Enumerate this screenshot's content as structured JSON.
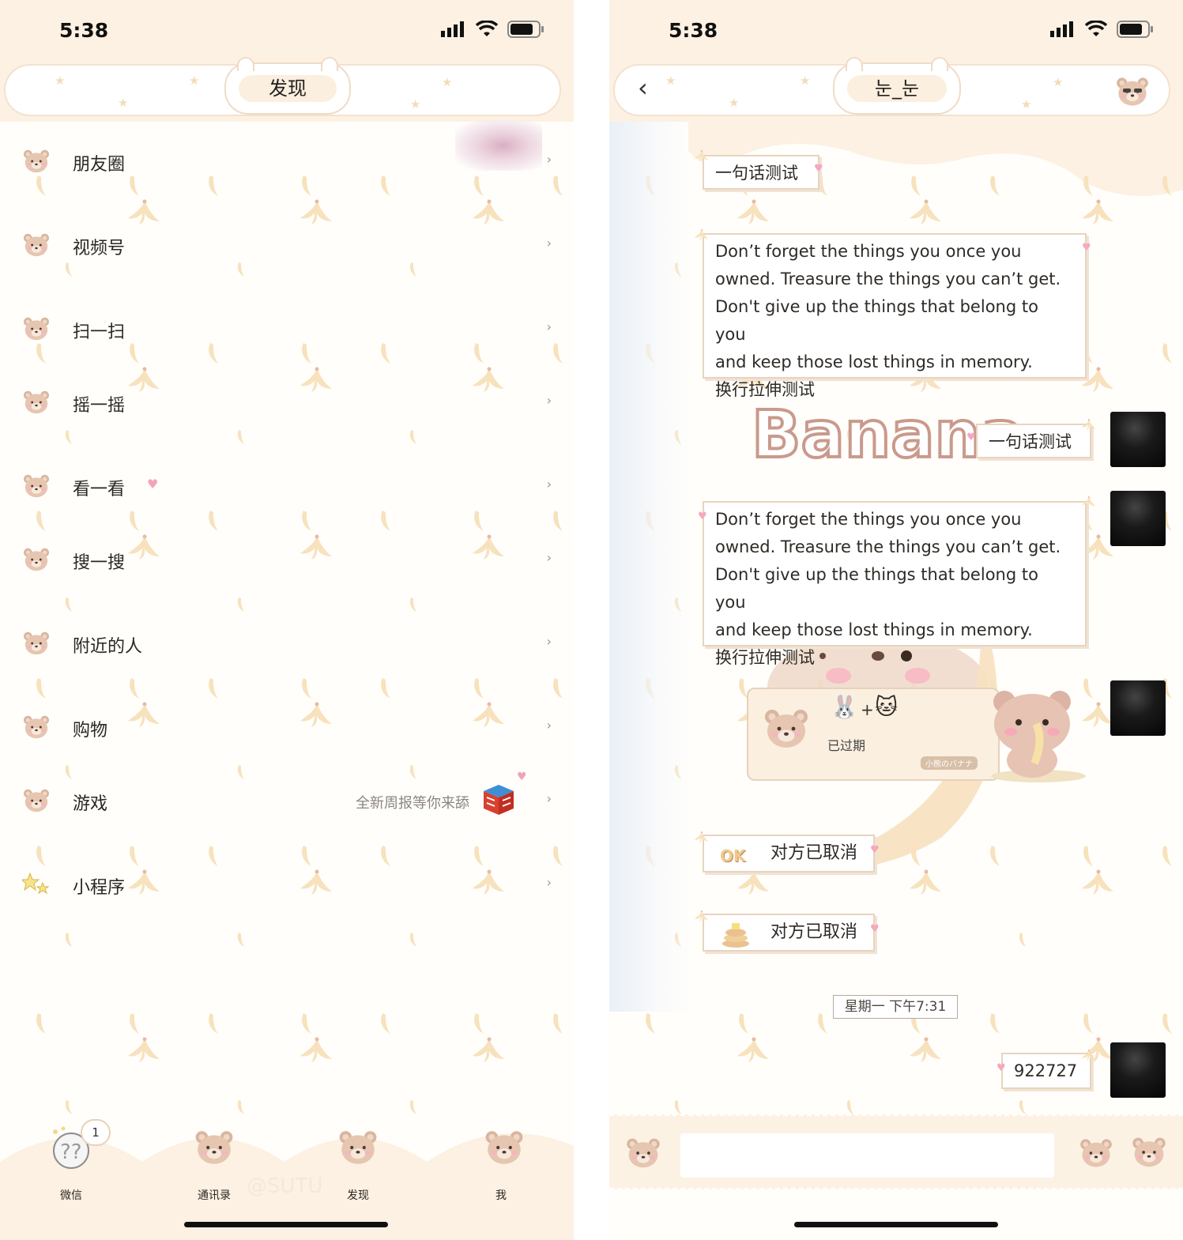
{
  "status": {
    "time": "5:38"
  },
  "discover": {
    "title": "发现",
    "items": [
      {
        "label": "朋友圈"
      },
      {
        "label": "视频号"
      },
      {
        "label": "扫一扫"
      },
      {
        "label": "摇一摇"
      },
      {
        "label": "看一看"
      },
      {
        "label": "搜一搜"
      },
      {
        "label": "附近的人"
      },
      {
        "label": "购物"
      },
      {
        "label": "游戏",
        "desc": "全新周报等你来舔"
      },
      {
        "label": "小程序"
      }
    ],
    "chevron": "›",
    "tabs": [
      {
        "label": "微信",
        "badge": "1"
      },
      {
        "label": "通讯录"
      },
      {
        "label": "发现"
      },
      {
        "label": "我"
      }
    ],
    "watermark": "@SUTU"
  },
  "chat": {
    "title": "눈_눈",
    "back": "‹",
    "messages": {
      "m1": "一句话测试",
      "m2": "Don’t forget the things you once you\nowned. Treasure the things you can’t get.\nDon't give up the things that belong to you\n and keep those lost things in memory.\n换行拉伸测试",
      "banana_art": "Banana",
      "m3": "一句话测试",
      "m4": "Don’t forget the things you once you\nowned. Treasure the things you can’t get.\nDon't give up the things that belong to you\n and keep those lost things in memory.\n换行拉伸测试",
      "card_status": "已过期",
      "card_plus": "+",
      "card_brand": "小熊のバナナ",
      "m5": "对方已取消",
      "m6": "对方已取消",
      "timestamp": "星期一 下午7:31",
      "m7": "922727"
    }
  },
  "colors": {
    "header_bg": "#fcf1e2",
    "bubble_border": "#e8d4bf",
    "banana_pattern": "#f7e2bd",
    "heart": "#f6a8bf"
  }
}
